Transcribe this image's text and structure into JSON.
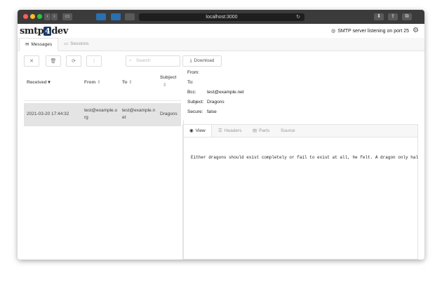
{
  "browser": {
    "url": "localhost:3000",
    "colors": {
      "close": "#fe5f57",
      "minimize": "#febc2e",
      "zoom": "#28c840"
    }
  },
  "app": {
    "logo_text": "smtp",
    "logo_box": "4",
    "logo_suffix": "dev",
    "status": "SMTP server listening on port 25"
  },
  "tabs": [
    {
      "label": "Messages",
      "icon": "mail-icon"
    },
    {
      "label": "Sessions",
      "icon": "monitor-icon"
    }
  ],
  "toolbar": {
    "delete_icon": "✕",
    "trash_icon": "🗑",
    "refresh_icon": "⟳",
    "forward_icon": "⟩",
    "search_placeholder": "Search",
    "download_label": "Download"
  },
  "table": {
    "columns": [
      "Received",
      "From",
      "To",
      "Subject"
    ],
    "rows": [
      {
        "received": "2021-03-20 17:44:32",
        "from": "test@example.org",
        "to": "test@example.net",
        "subject": "Dragons"
      }
    ]
  },
  "message": {
    "from_label": "From:",
    "from_value": "",
    "to_label": "To:",
    "to_value": "",
    "bcc_label": "Bcc:",
    "bcc_value": "test@example.net",
    "subject_label": "Subject:",
    "subject_value": "Dragons",
    "secure_label": "Secure:",
    "secure_value": "false"
  },
  "preview": {
    "tabs": [
      "View",
      "Headers",
      "Parts",
      "Source"
    ],
    "body": "Either dragons should exist completely or fail to exist at all, he felt. A dragon only hal"
  }
}
